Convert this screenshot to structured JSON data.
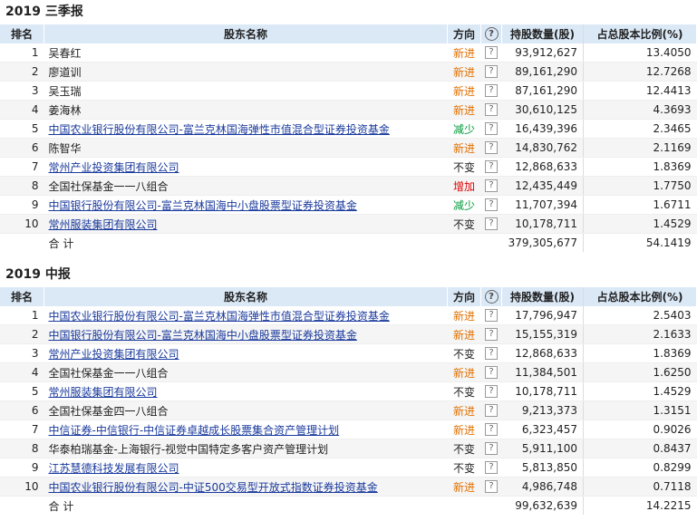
{
  "sections": [
    {
      "title": "2019 三季报",
      "headers": {
        "rank": "排名",
        "name": "股东名称",
        "direction": "方向",
        "help": "?",
        "shares": "持股数量(股)",
        "pct": "占总股本比例(%)"
      },
      "rows": [
        {
          "rank": "1",
          "name": "吴春红",
          "link": false,
          "direction": "新进",
          "dir_type": "xin",
          "q": "?",
          "shares": "93,912,627",
          "pct": "13.4050"
        },
        {
          "rank": "2",
          "name": "廖道训",
          "link": false,
          "direction": "新进",
          "dir_type": "xin",
          "q": "?",
          "shares": "89,161,290",
          "pct": "12.7268"
        },
        {
          "rank": "3",
          "name": "吴玉瑞",
          "link": false,
          "direction": "新进",
          "dir_type": "xin",
          "q": "?",
          "shares": "87,161,290",
          "pct": "12.4413"
        },
        {
          "rank": "4",
          "name": "姜海林",
          "link": false,
          "direction": "新进",
          "dir_type": "xin",
          "q": "?",
          "shares": "30,610,125",
          "pct": "4.3693"
        },
        {
          "rank": "5",
          "name": "中国农业银行股份有限公司-富兰克林国海弹性市值混合型证券投资基金",
          "link": true,
          "direction": "减少",
          "dir_type": "jian",
          "q": "?",
          "shares": "16,439,396",
          "pct": "2.3465"
        },
        {
          "rank": "6",
          "name": "陈智华",
          "link": false,
          "direction": "新进",
          "dir_type": "xin",
          "q": "?",
          "shares": "14,830,762",
          "pct": "2.1169"
        },
        {
          "rank": "7",
          "name": "常州产业投资集团有限公司",
          "link": true,
          "direction": "不变",
          "dir_type": "bu",
          "q": "?",
          "shares": "12,868,633",
          "pct": "1.8369"
        },
        {
          "rank": "8",
          "name": "全国社保基金一一八组合",
          "link": false,
          "direction": "增加",
          "dir_type": "zeng",
          "q": "?",
          "shares": "12,435,449",
          "pct": "1.7750"
        },
        {
          "rank": "9",
          "name": "中国银行股份有限公司-富兰克林国海中小盘股票型证券投资基金",
          "link": true,
          "direction": "减少",
          "dir_type": "jian",
          "q": "?",
          "shares": "11,707,394",
          "pct": "1.6711"
        },
        {
          "rank": "10",
          "name": "常州服装集团有限公司",
          "link": true,
          "direction": "不变",
          "dir_type": "bu",
          "q": "?",
          "shares": "10,178,711",
          "pct": "1.4529"
        }
      ],
      "total": {
        "label": "合  计",
        "shares": "379,305,677",
        "pct": "54.1419"
      }
    },
    {
      "title": "2019 中报",
      "headers": {
        "rank": "排名",
        "name": "股东名称",
        "direction": "方向",
        "help": "?",
        "shares": "持股数量(股)",
        "pct": "占总股本比例(%)"
      },
      "rows": [
        {
          "rank": "1",
          "name": "中国农业银行股份有限公司-富兰克林国海弹性市值混合型证券投资基金",
          "link": true,
          "direction": "新进",
          "dir_type": "xin",
          "q": "?",
          "shares": "17,796,947",
          "pct": "2.5403"
        },
        {
          "rank": "2",
          "name": "中国银行股份有限公司-富兰克林国海中小盘股票型证券投资基金",
          "link": true,
          "direction": "新进",
          "dir_type": "xin",
          "q": "?",
          "shares": "15,155,319",
          "pct": "2.1633"
        },
        {
          "rank": "3",
          "name": "常州产业投资集团有限公司",
          "link": true,
          "direction": "不变",
          "dir_type": "bu",
          "q": "?",
          "shares": "12,868,633",
          "pct": "1.8369"
        },
        {
          "rank": "4",
          "name": "全国社保基金一一八组合",
          "link": false,
          "direction": "新进",
          "dir_type": "xin",
          "q": "?",
          "shares": "11,384,501",
          "pct": "1.6250"
        },
        {
          "rank": "5",
          "name": "常州服装集团有限公司",
          "link": true,
          "direction": "不变",
          "dir_type": "bu",
          "q": "?",
          "shares": "10,178,711",
          "pct": "1.4529"
        },
        {
          "rank": "6",
          "name": "全国社保基金四一八组合",
          "link": false,
          "direction": "新进",
          "dir_type": "xin",
          "q": "?",
          "shares": "9,213,373",
          "pct": "1.3151"
        },
        {
          "rank": "7",
          "name": "中信证券-中信银行-中信证券卓越成长股票集合资产管理计划",
          "link": true,
          "direction": "新进",
          "dir_type": "xin",
          "q": "?",
          "shares": "6,323,457",
          "pct": "0.9026"
        },
        {
          "rank": "8",
          "name": "华泰柏瑞基金-上海银行-视觉中国特定多客户资产管理计划",
          "link": false,
          "direction": "不变",
          "dir_type": "bu",
          "q": "?",
          "shares": "5,911,100",
          "pct": "0.8437"
        },
        {
          "rank": "9",
          "name": "江苏慧德科技发展有限公司",
          "link": true,
          "direction": "不变",
          "dir_type": "bu",
          "q": "?",
          "shares": "5,813,850",
          "pct": "0.8299"
        },
        {
          "rank": "10",
          "name": "中国农业银行股份有限公司-中证500交易型开放式指数证券投资基金",
          "link": true,
          "direction": "新进",
          "dir_type": "xin",
          "q": "?",
          "shares": "4,986,748",
          "pct": "0.7118"
        }
      ],
      "total": {
        "label": "合  计",
        "shares": "99,632,639",
        "pct": "14.2215"
      }
    }
  ],
  "colors": {
    "header_bg": "#dbe9f7",
    "link": "#1a3a9c",
    "new": "#e07000",
    "decrease": "#009a3a",
    "increase": "#e00000"
  }
}
